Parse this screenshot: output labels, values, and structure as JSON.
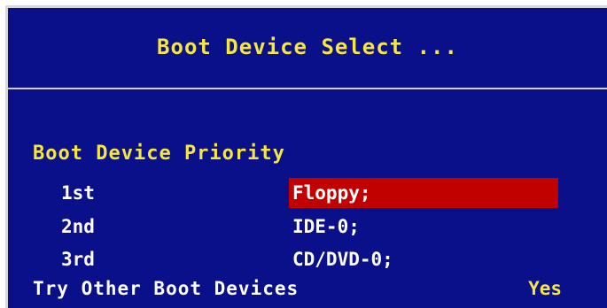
{
  "window": {
    "title": "Boot Device Select ..."
  },
  "section": {
    "heading": "Boot Device Priority"
  },
  "boot_order": [
    {
      "label": "1st",
      "value": "Floppy;",
      "selected": true
    },
    {
      "label": "2nd",
      "value": "IDE-0;",
      "selected": false
    },
    {
      "label": "3rd",
      "value": "CD/DVD-0;",
      "selected": false
    }
  ],
  "other_boot": {
    "label": "Try Other Boot Devices",
    "value": "Yes"
  },
  "colors": {
    "background": "#0a0f8a",
    "heading_text": "#f5e642",
    "normal_text": "#ffffff",
    "highlight": "#c10000",
    "border": "#d8d8d8"
  }
}
